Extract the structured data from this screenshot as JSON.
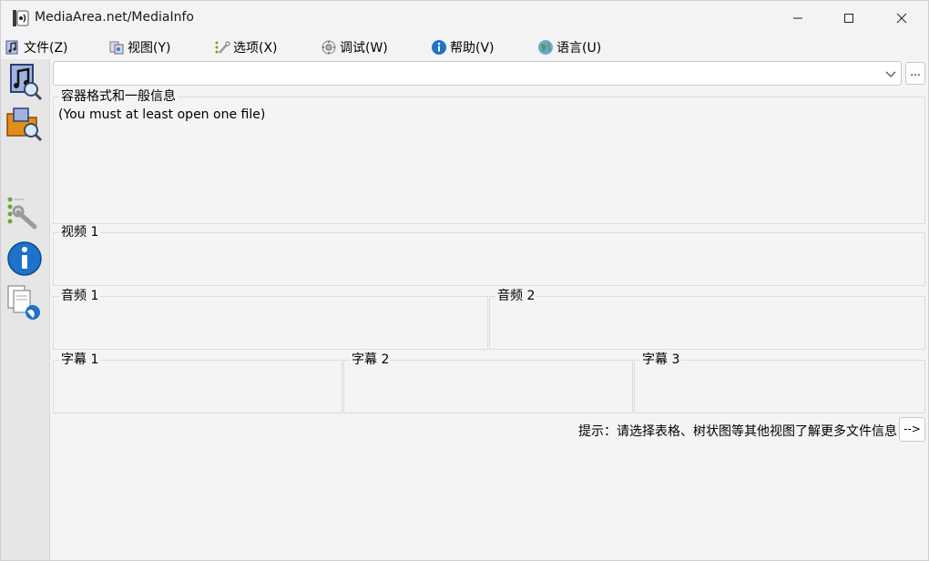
{
  "window": {
    "title": "MediaArea.net/MediaInfo"
  },
  "menu": {
    "items": [
      {
        "label": "文件(Z)",
        "icon": "file-music-icon"
      },
      {
        "label": "视图(Y)",
        "icon": "view-icon"
      },
      {
        "label": "选项(X)",
        "icon": "options-icon"
      },
      {
        "label": "调试(W)",
        "icon": "debug-icon"
      },
      {
        "label": "帮助(V)",
        "icon": "help-icon"
      },
      {
        "label": "语言(U)",
        "icon": "language-globe-icon"
      }
    ]
  },
  "file_selector": {
    "value": "",
    "browse_label": "..."
  },
  "sections": {
    "general": {
      "label": "容器格式和一般信息",
      "text": "(You must at least open one file)"
    },
    "video1": {
      "label": "视频 1"
    },
    "audio1": {
      "label": "音频 1"
    },
    "audio2": {
      "label": "音频 2"
    },
    "text1": {
      "label": "字幕 1"
    },
    "text2": {
      "label": "字幕 2"
    },
    "text3": {
      "label": "字幕 3"
    }
  },
  "hint": {
    "text": "提示：请选择表格、树状图等其他视图了解更多文件信息",
    "button": "-->"
  },
  "colors": {
    "accent": "#1e72c8",
    "folder": "#e38d1a"
  }
}
